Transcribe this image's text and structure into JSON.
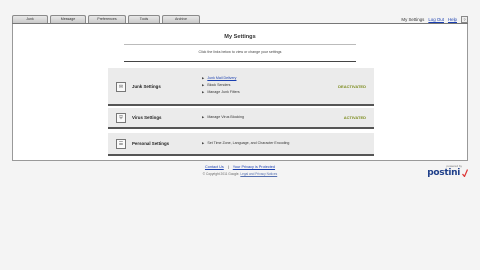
{
  "tabs": [
    "Junk",
    "Message",
    "Preferences",
    "Tools",
    "Archive"
  ],
  "header": {
    "settings_label": "My Settings",
    "logout": "Log Out",
    "help": "Help",
    "help_icon": "?"
  },
  "page": {
    "title": "My Settings",
    "intro": "Click the links below to view or change your settings"
  },
  "sections": [
    {
      "label": "Junk Settings",
      "icon": "junk-settings-icon",
      "links": [
        "Junk Mail Delivery",
        "Block Senders",
        "Manage Junk Filters"
      ],
      "status": "DEACTIVATED"
    },
    {
      "label": "Virus Settings",
      "icon": "virus-settings-icon",
      "links": [
        "Manage Virus Blocking"
      ],
      "status": "ACTIVATED"
    },
    {
      "label": "Personal Settings",
      "icon": "personal-settings-icon",
      "links": [
        "Set Time Zone, Language, and Character Encoding"
      ],
      "status": ""
    }
  ],
  "footer": {
    "contact": "Contact Us",
    "privacy": "Your Privacy is Protected",
    "copyright": "© Copyright 2011 Google.",
    "legal": "Legal and Privacy Notices"
  },
  "logo": {
    "powered_by": "powered by",
    "name": "postini"
  },
  "colors": {
    "status": "#7a8a1a",
    "link": "#1a3fb0",
    "logo": "#1f3f8a"
  }
}
